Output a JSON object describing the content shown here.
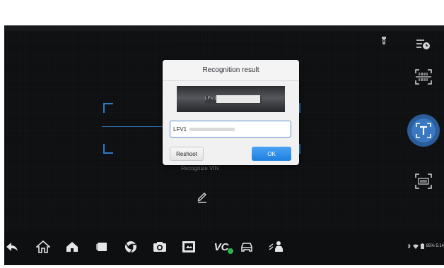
{
  "dialog": {
    "title": "Recognition result",
    "thumbnail_text": "LFV1",
    "input_value": "LFV1",
    "reshoot_label": "Reshoot",
    "ok_label": "OK"
  },
  "scanner": {
    "recognize_label": "Recognize VIN",
    "frame_color": "#2e7ac8"
  },
  "tools": {
    "selected": "text-recognition",
    "items": [
      "history-icon",
      "barcode-scan-icon",
      "text-recognition-icon",
      "vin-scan-icon"
    ],
    "accent": "#3a78c2"
  },
  "navbar": {
    "vc_label": "VC",
    "items": [
      "back-icon",
      "home-icon",
      "house-icon",
      "recent-apps-icon",
      "browser-icon",
      "camera-icon",
      "screenshot-icon",
      "vc-icon",
      "car-icon",
      "user-car-icon"
    ]
  },
  "status": {
    "text": "85% 5:14",
    "icons": [
      "bluetooth-icon",
      "wifi-icon",
      "battery-icon"
    ]
  }
}
